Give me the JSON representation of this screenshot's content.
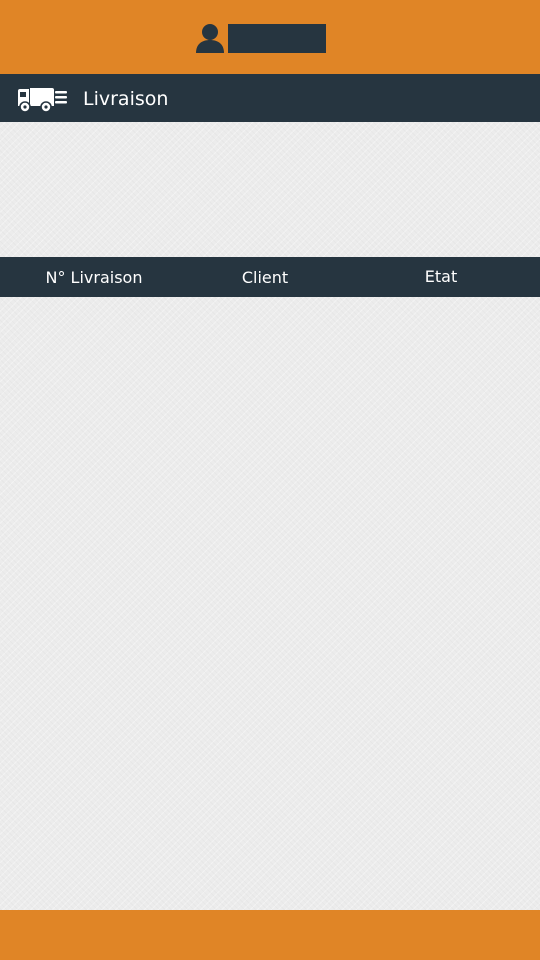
{
  "header": {
    "user_icon": "user-icon",
    "user_name": ""
  },
  "section": {
    "icon": "delivery-truck-icon",
    "title": "Livraison"
  },
  "table": {
    "columns": [
      "N° Livraison",
      "Client",
      "Etat"
    ],
    "rows": []
  },
  "colors": {
    "accent": "#e08526",
    "dark": "#263540",
    "background": "#ececec"
  }
}
